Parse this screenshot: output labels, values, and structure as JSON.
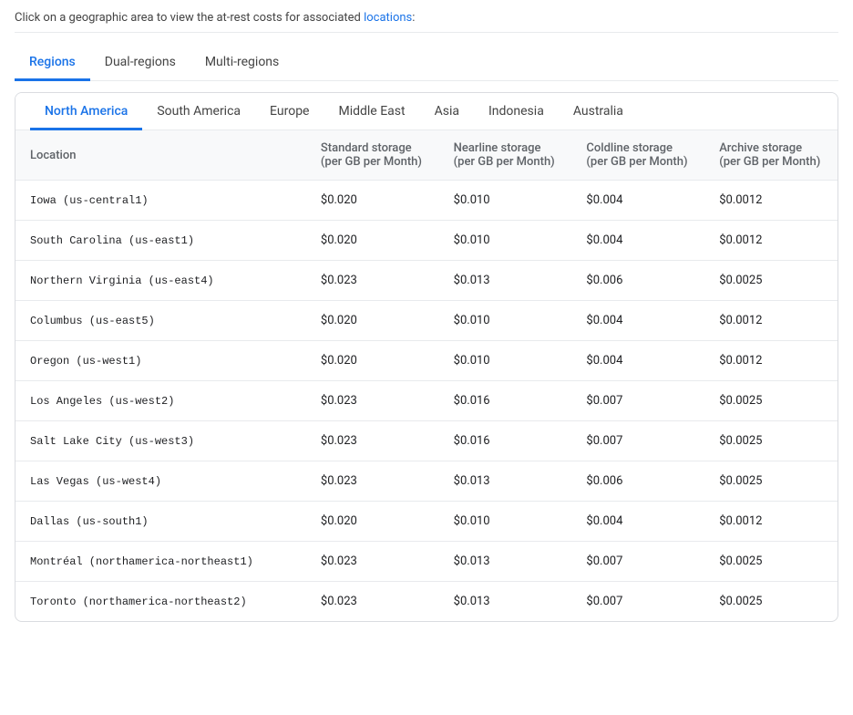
{
  "instruction": {
    "text": "Click on a geographic area to view the at-rest costs for associated ",
    "link_text": "locations",
    "link_href": "#"
  },
  "top_tabs": [
    {
      "label": "Regions",
      "active": true
    },
    {
      "label": "Dual-regions",
      "active": false
    },
    {
      "label": "Multi-regions",
      "active": false
    }
  ],
  "geo_tabs": [
    {
      "label": "North America",
      "active": true
    },
    {
      "label": "South America",
      "active": false
    },
    {
      "label": "Europe",
      "active": false
    },
    {
      "label": "Middle East",
      "active": false
    },
    {
      "label": "Asia",
      "active": false
    },
    {
      "label": "Indonesia",
      "active": false
    },
    {
      "label": "Australia",
      "active": false
    }
  ],
  "table": {
    "columns": [
      {
        "id": "location",
        "label": "Location"
      },
      {
        "id": "standard",
        "label": "Standard storage\n(per GB per Month)"
      },
      {
        "id": "nearline",
        "label": "Nearline storage\n(per GB per Month)"
      },
      {
        "id": "coldline",
        "label": "Coldline storage\n(per GB per Month)"
      },
      {
        "id": "archive",
        "label": "Archive storage\n(per GB per Month)"
      }
    ],
    "rows": [
      {
        "location": "Iowa (us-central1)",
        "standard": "$0.020",
        "nearline": "$0.010",
        "coldline": "$0.004",
        "archive": "$0.0012"
      },
      {
        "location": "South Carolina (us-east1)",
        "standard": "$0.020",
        "nearline": "$0.010",
        "coldline": "$0.004",
        "archive": "$0.0012"
      },
      {
        "location": "Northern Virginia (us-east4)",
        "standard": "$0.023",
        "nearline": "$0.013",
        "coldline": "$0.006",
        "archive": "$0.0025"
      },
      {
        "location": "Columbus (us-east5)",
        "standard": "$0.020",
        "nearline": "$0.010",
        "coldline": "$0.004",
        "archive": "$0.0012"
      },
      {
        "location": "Oregon (us-west1)",
        "standard": "$0.020",
        "nearline": "$0.010",
        "coldline": "$0.004",
        "archive": "$0.0012"
      },
      {
        "location": "Los Angeles (us-west2)",
        "standard": "$0.023",
        "nearline": "$0.016",
        "coldline": "$0.007",
        "archive": "$0.0025"
      },
      {
        "location": "Salt Lake City (us-west3)",
        "standard": "$0.023",
        "nearline": "$0.016",
        "coldline": "$0.007",
        "archive": "$0.0025"
      },
      {
        "location": "Las Vegas (us-west4)",
        "standard": "$0.023",
        "nearline": "$0.013",
        "coldline": "$0.006",
        "archive": "$0.0025"
      },
      {
        "location": "Dallas (us-south1)",
        "standard": "$0.020",
        "nearline": "$0.010",
        "coldline": "$0.004",
        "archive": "$0.0012"
      },
      {
        "location": "Montréal (northamerica-northeast1)",
        "standard": "$0.023",
        "nearline": "$0.013",
        "coldline": "$0.007",
        "archive": "$0.0025"
      },
      {
        "location": "Toronto (northamerica-northeast2)",
        "standard": "$0.023",
        "nearline": "$0.013",
        "coldline": "$0.007",
        "archive": "$0.0025"
      }
    ]
  }
}
